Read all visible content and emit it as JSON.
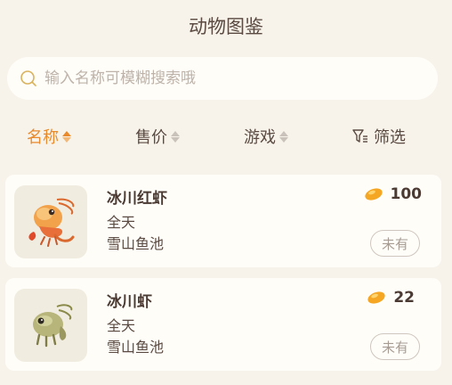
{
  "header": {
    "title": "动物图鉴"
  },
  "search": {
    "placeholder": "输入名称可模糊搜索哦",
    "value": ""
  },
  "sort": {
    "items": [
      {
        "label": "名称",
        "active": true
      },
      {
        "label": "售价",
        "active": false
      },
      {
        "label": "游戏",
        "active": false
      }
    ],
    "filter_label": "筛选"
  },
  "colors": {
    "accent": "#e98a2c",
    "background": "#f7f3eb",
    "card": "#fffdf8"
  },
  "items": [
    {
      "name": "冰川红虾",
      "time": "全天",
      "location": "雪山鱼池",
      "price": "100",
      "status": "未有",
      "icon": "red-shrimp-icon"
    },
    {
      "name": "冰川虾",
      "time": "全天",
      "location": "雪山鱼池",
      "price": "22",
      "status": "未有",
      "icon": "green-shrimp-icon"
    }
  ]
}
